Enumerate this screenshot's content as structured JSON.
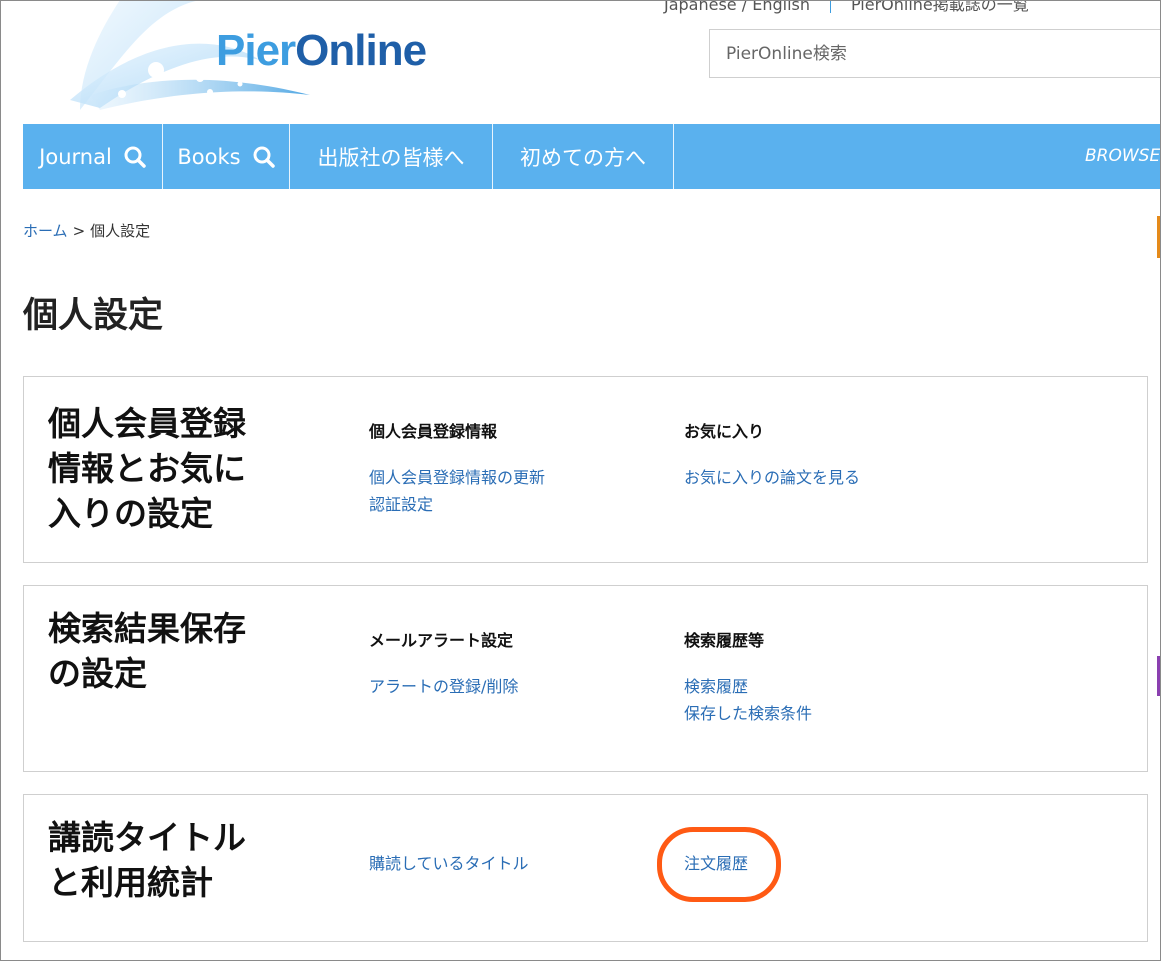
{
  "header": {
    "logo": {
      "part1": "Pier",
      "part2": "Online"
    },
    "top_links": {
      "language": "Japanese / English",
      "about": "PierOnline掲載誌の一覧"
    },
    "search": {
      "placeholder": "PierOnline検索"
    }
  },
  "nav": {
    "items": [
      {
        "label": "Journal",
        "has_search_icon": true
      },
      {
        "label": "Books",
        "has_search_icon": true
      },
      {
        "label": "出版社の皆様へ",
        "has_search_icon": false
      },
      {
        "label": "初めての方へ",
        "has_search_icon": false
      }
    ],
    "browse_label": "BROWSE BY"
  },
  "breadcrumb": {
    "home": "ホーム",
    "separator": ">",
    "current": "個人設定"
  },
  "page_title": "個人設定",
  "cards": [
    {
      "title": "個人会員登録情報とお気に入りの設定",
      "title_lines": [
        "個人会員登録",
        "情報とお気に",
        "入りの設定"
      ],
      "columns": [
        {
          "heading": "個人会員登録情報",
          "links": [
            "個人会員登録情報の更新",
            "認証設定"
          ]
        },
        {
          "heading": "お気に入り",
          "links": [
            "お気に入りの論文を見る"
          ]
        }
      ]
    },
    {
      "title": "検索結果保存の設定",
      "title_lines": [
        "検索結果保存",
        "の設定"
      ],
      "columns": [
        {
          "heading": "メールアラート設定",
          "links": [
            "アラートの登録/削除"
          ]
        },
        {
          "heading": "検索履歴等",
          "links": [
            "検索履歴",
            "保存した検索条件"
          ]
        }
      ]
    },
    {
      "title": "講読タイトルと利用統計",
      "title_lines": [
        "講読タイトル",
        "と利用統計"
      ],
      "columns": [
        {
          "heading": "",
          "links": [
            "購読しているタイトル"
          ]
        },
        {
          "heading": "",
          "links": [
            "注文履歴"
          ]
        }
      ]
    }
  ],
  "colors": {
    "nav_background": "#5ab1ee",
    "link": "#2a6db5",
    "highlight_circle": "#ff5a14"
  }
}
